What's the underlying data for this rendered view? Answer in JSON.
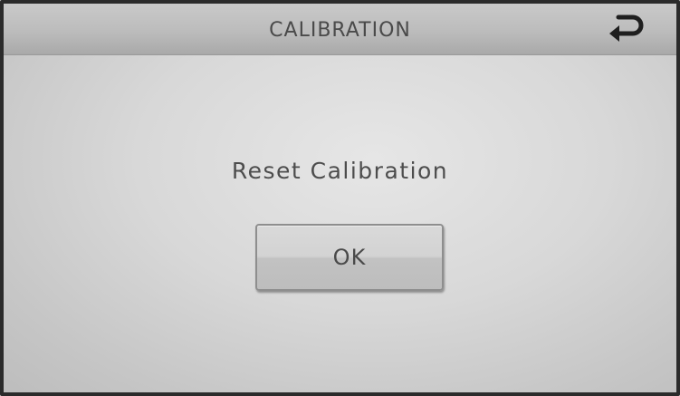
{
  "header": {
    "title": "CALIBRATION",
    "back_icon": "return-arrow-icon"
  },
  "dialog": {
    "message": "Reset Calibration",
    "ok_label": "OK"
  },
  "colors": {
    "title_bar": "#bcbcbc",
    "screen_background": "#d8d8d8",
    "text": "#4a4a4a",
    "icon": "#1f1f1f"
  }
}
